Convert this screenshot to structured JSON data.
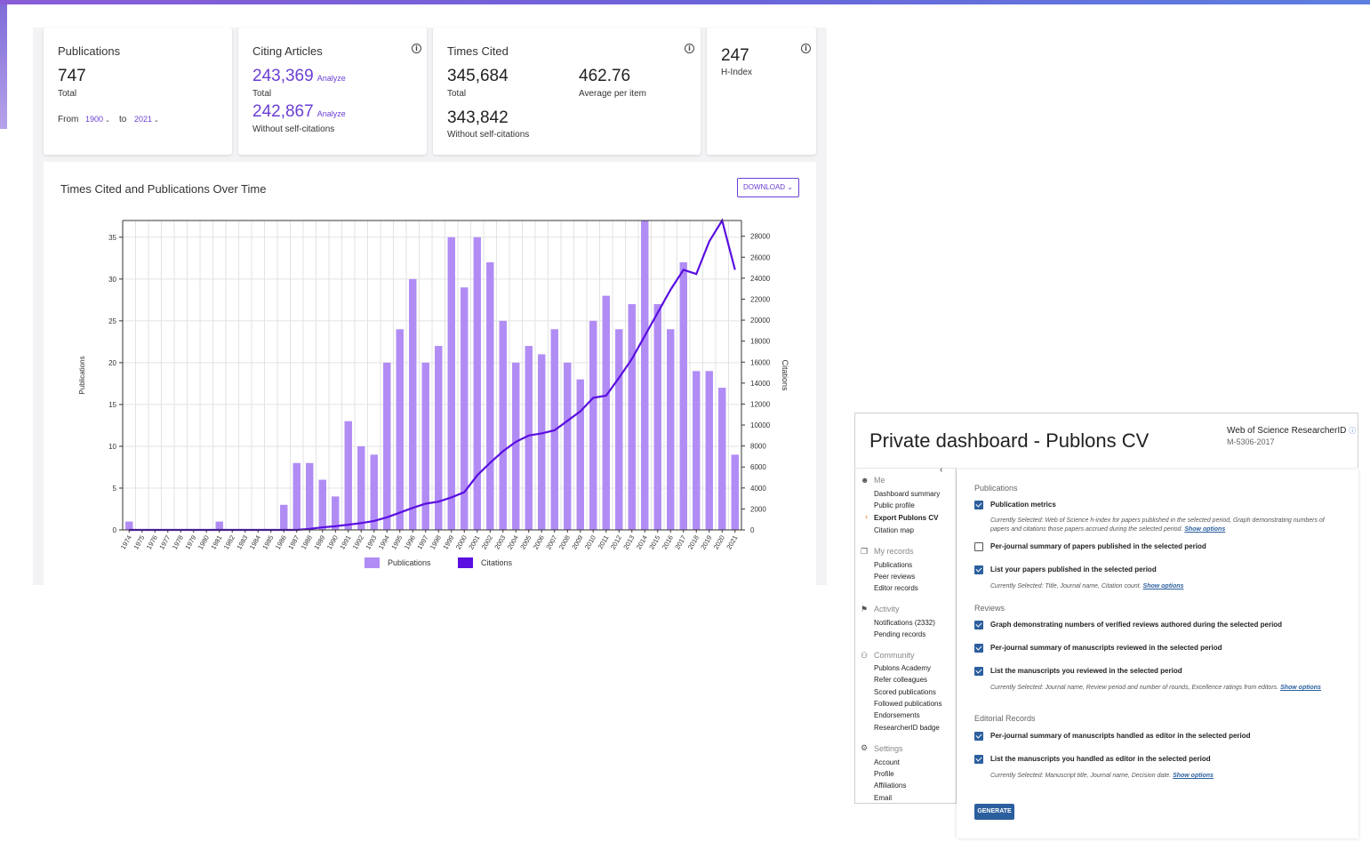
{
  "metrics": {
    "publications": {
      "label": "Publications",
      "value": "747",
      "sub": "Total",
      "from_label": "From",
      "from_value": "1900",
      "to_label": "to",
      "to_value": "2021"
    },
    "citing": {
      "label": "Citing Articles",
      "total_value": "243,369",
      "total_action": "Analyze",
      "total_sub": "Total",
      "wo_value": "242,867",
      "wo_action": "Analyze",
      "wo_sub": "Without self-citations"
    },
    "times_cited": {
      "label": "Times Cited",
      "total_value": "345,684",
      "total_sub": "Total",
      "avg_value": "462.76",
      "avg_sub": "Average per item",
      "wo_value": "343,842",
      "wo_sub": "Without self-citations"
    },
    "hindex": {
      "value": "247",
      "label": "H-Index"
    },
    "info_icon": "i"
  },
  "chart_header": {
    "title": "Times Cited and Publications Over Time",
    "download_label": "DOWNLOAD ⌄"
  },
  "chart_data": {
    "type": "bar",
    "title": "Times Cited and Publications Over Time",
    "xlabel": "",
    "ylabel": "Publications",
    "y2label": "Citations",
    "categories": [
      "1974",
      "1975",
      "1976",
      "1977",
      "1978",
      "1979",
      "1980",
      "1981",
      "1982",
      "1983",
      "1984",
      "1985",
      "1986",
      "1987",
      "1988",
      "1989",
      "1990",
      "1991",
      "1992",
      "1993",
      "1994",
      "1995",
      "1996",
      "1997",
      "1998",
      "1999",
      "2000",
      "2001",
      "2002",
      "2003",
      "2004",
      "2005",
      "2006",
      "2007",
      "2008",
      "2009",
      "2010",
      "2011",
      "2012",
      "2013",
      "2014",
      "2015",
      "2016",
      "2017",
      "2018",
      "2019",
      "2020",
      "2021"
    ],
    "series": [
      {
        "name": "Publications",
        "type": "bar",
        "axis": "left",
        "color": "#b18cf5",
        "values": [
          1,
          0,
          0,
          0,
          0,
          0,
          0,
          1,
          0,
          0,
          0,
          0,
          3,
          8,
          8,
          6,
          4,
          13,
          10,
          9,
          20,
          24,
          30,
          20,
          22,
          35,
          29,
          35,
          32,
          25,
          20,
          22,
          21,
          24,
          20,
          18,
          25,
          28,
          24,
          27,
          37,
          27,
          24,
          32,
          19,
          19,
          17,
          9
        ]
      },
      {
        "name": "Citations",
        "type": "line",
        "axis": "right",
        "color": "#5a0fe0",
        "values": [
          0,
          0,
          0,
          0,
          0,
          0,
          0,
          0,
          0,
          0,
          0,
          0,
          0,
          0,
          100,
          250,
          350,
          500,
          650,
          850,
          1200,
          1650,
          2100,
          2500,
          2700,
          3100,
          3600,
          5200,
          6400,
          7500,
          8400,
          9000,
          9200,
          9500,
          10400,
          11300,
          12600,
          12800,
          14500,
          16300,
          18500,
          20700,
          22900,
          24800,
          24400,
          27500,
          29500,
          24800
        ]
      }
    ],
    "ylim": [
      0,
      37
    ],
    "y_ticks": [
      0,
      5,
      10,
      15,
      20,
      25,
      30,
      35
    ],
    "y2lim": [
      0,
      29500
    ],
    "y2_ticks": [
      0,
      2000,
      4000,
      6000,
      8000,
      10000,
      12000,
      14000,
      16000,
      18000,
      20000,
      22000,
      24000,
      26000,
      28000
    ],
    "grid": true,
    "legend": "bottom"
  },
  "cv": {
    "title": "Private dashboard - Publons CV",
    "wos_label": "Web of Science ResearcherID",
    "wos_id": "M-5306-2017",
    "sidebar": {
      "collapse": "‹",
      "groups": [
        {
          "label": "Me",
          "icon": "☻",
          "items": [
            "Dashboard summary",
            "Public profile",
            "Export Publons CV",
            "Citation map"
          ]
        },
        {
          "label": "My records",
          "icon": "❐",
          "items": [
            "Publications",
            "Peer reviews",
            "Editor records"
          ]
        },
        {
          "label": "Activity",
          "icon": "⚑",
          "items": [
            "Notifications (2332)",
            "Pending records"
          ]
        },
        {
          "label": "Community",
          "icon": "⚇",
          "items": [
            "Publons Academy",
            "Refer colleagues",
            "Scored publications",
            "Followed publications",
            "Endorsements",
            "ResearcherID badge"
          ]
        },
        {
          "label": "Settings",
          "icon": "⚙",
          "items": [
            "Account",
            "Profile",
            "Affiliations",
            "Email"
          ]
        }
      ],
      "active_arrow": "›"
    },
    "sections": {
      "publications": "Publications",
      "reviews": "Reviews",
      "editorial": "Editorial Records"
    },
    "options": {
      "pub_metrics": "Publication metrics",
      "pub_metrics_note": "Currently Selected: Web of Science h-index for papers published in the selected period, Graph demonstrating numbers of papers and citations those papers accrued during the selected period.",
      "per_journal_papers": "Per-journal summary of papers published in the selected period",
      "list_papers": "List your papers published in the selected period",
      "list_papers_note": "Currently Selected: Title, Journal name, Citation count.",
      "graph_reviews": "Graph demonstrating numbers of verified reviews authored during the selected period",
      "per_journal_reviews": "Per-journal summary of manuscripts reviewed in the selected period",
      "list_reviews": "List the manuscripts you reviewed in the selected period",
      "list_reviews_note": "Currently Selected: Journal name, Review period and number of rounds, Excellence ratings from editors.",
      "per_journal_editor": "Per-journal summary of manuscripts handled as editor in the selected period",
      "list_editor": "List the manuscripts you handled as editor in the selected period",
      "list_editor_note": "Currently Selected: Manuscript title, Journal name, Decision date.",
      "show_options": "Show options"
    },
    "generate": "GENERATE"
  }
}
